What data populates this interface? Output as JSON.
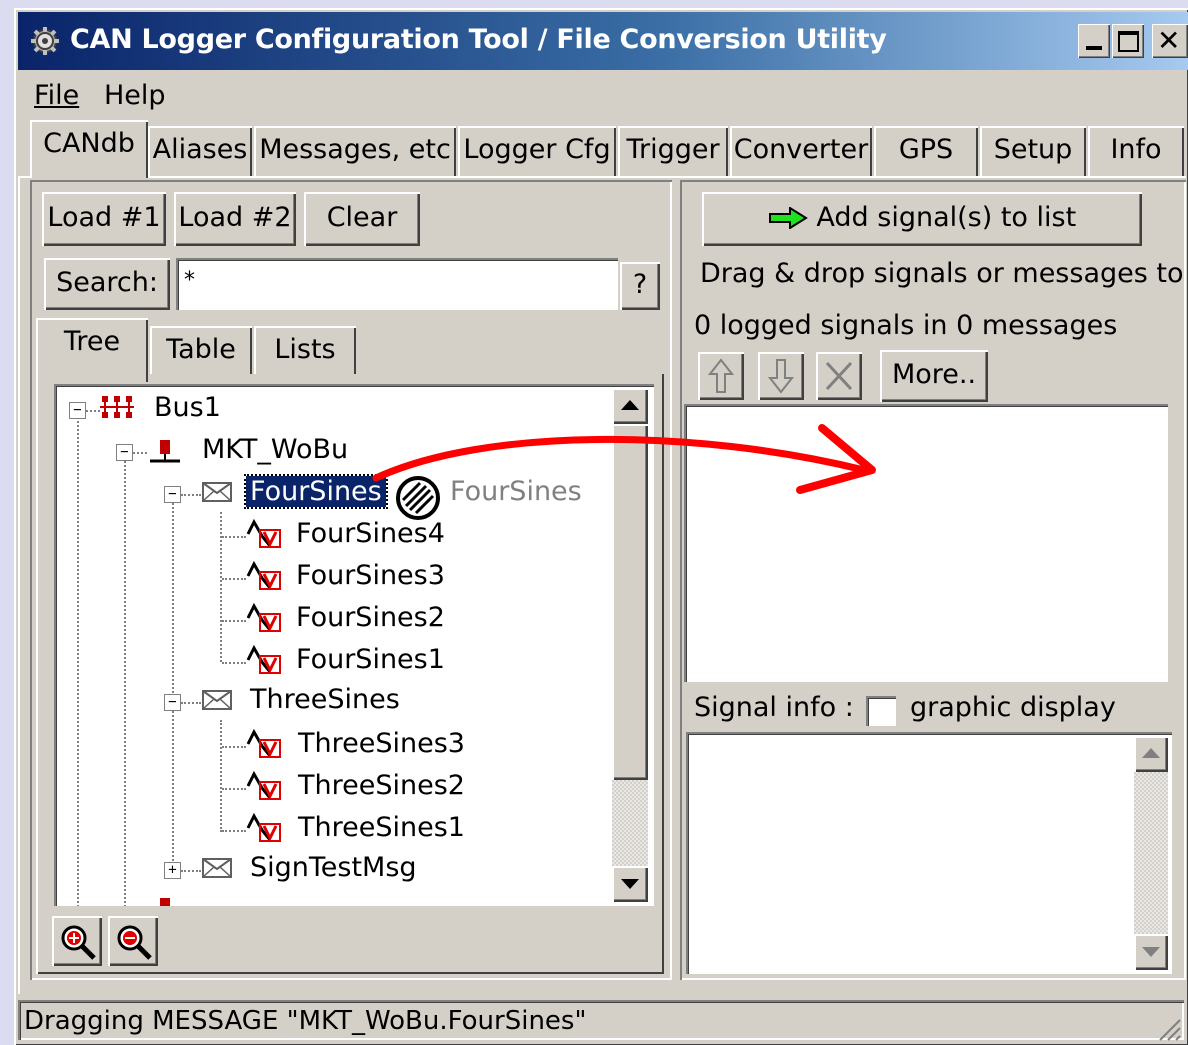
{
  "window": {
    "title": "CAN Logger Configuration Tool / File Conversion Utility"
  },
  "titlebar_buttons": [
    "minimize-icon",
    "maximize-icon",
    "close-icon"
  ],
  "menu": {
    "file": "File",
    "help": "Help"
  },
  "tabs": [
    "CANdb",
    "Aliases",
    "Messages, etc",
    "Logger Cfg",
    "Trigger",
    "Converter",
    "GPS",
    "Setup",
    "Info"
  ],
  "left": {
    "load1": "Load #1",
    "load2": "Load #2",
    "clear": "Clear",
    "search_label": "Search:",
    "search_value": "*",
    "help_btn": "?",
    "subtabs": [
      "Tree",
      "Table",
      "Lists"
    ],
    "tree": {
      "bus": "Bus1",
      "node": "MKT_WoBu",
      "msg1": "FourSines",
      "msg1_signals": [
        "FourSines4",
        "FourSines3",
        "FourSines2",
        "FourSines1"
      ],
      "msg2": "ThreeSines",
      "msg2_signals": [
        "ThreeSines3",
        "ThreeSines2",
        "ThreeSines1"
      ],
      "msg3": "SignTestMsg"
    },
    "drag_ghost": "FourSines",
    "zoom_in": "zoom-in-icon",
    "zoom_out": "zoom-out-icon"
  },
  "right": {
    "add_signals": "Add signal(s) to list",
    "hint": "Drag & drop signals or messages to log .",
    "count": "0 logged signals in 0 messages",
    "more": "More..",
    "signal_info_label": "Signal info :",
    "graphic_display": "graphic display",
    "graphic_checked": false
  },
  "status": {
    "text": "Dragging MESSAGE \"MKT_WoBu.FourSines\""
  },
  "colors": {
    "title_start": "#0a246a",
    "title_end": "#a6caf0",
    "selection": "#0a246a",
    "annotation_arrow": "#ff0000"
  }
}
